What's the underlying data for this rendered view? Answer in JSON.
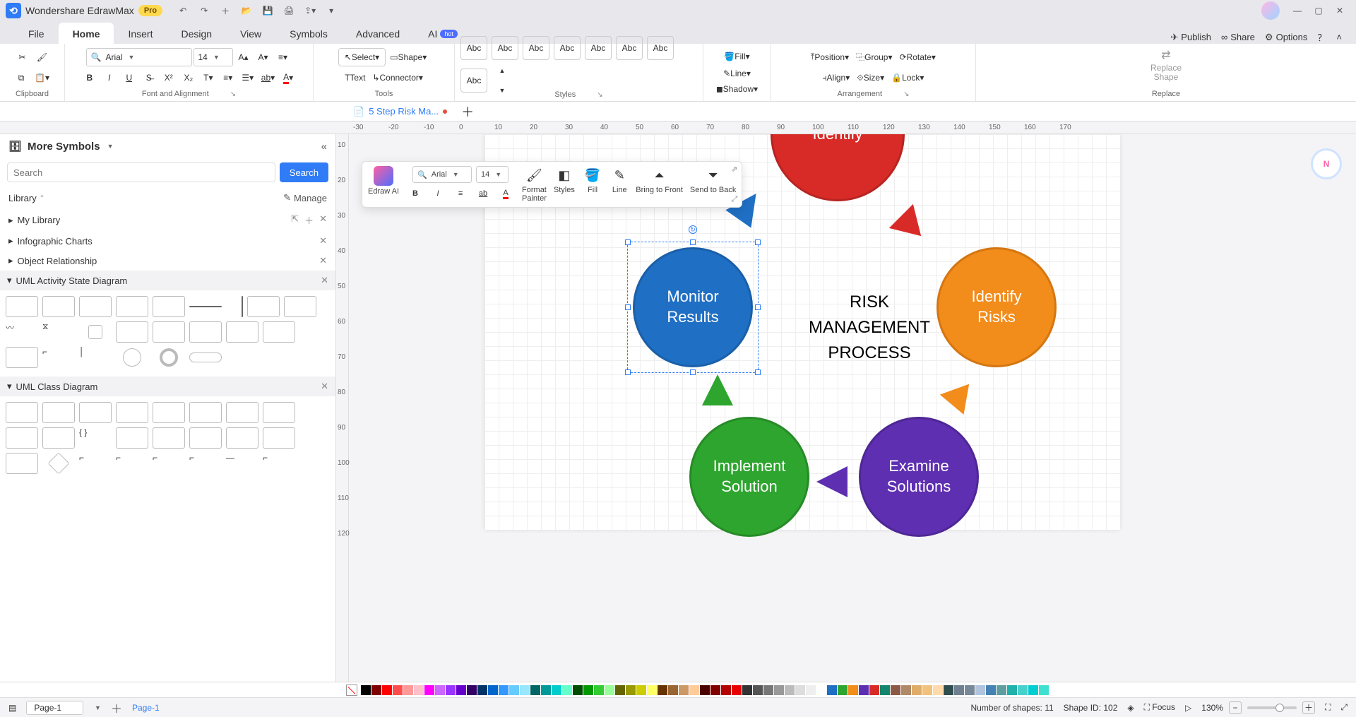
{
  "app": {
    "name": "Wondershare EdrawMax",
    "badge": "Pro"
  },
  "menus": [
    "File",
    "Home",
    "Insert",
    "Design",
    "View",
    "Symbols",
    "Advanced",
    "AI"
  ],
  "menu_active": 1,
  "menu_hot": "hot",
  "top_right": {
    "publish": "Publish",
    "share": "Share",
    "options": "Options"
  },
  "ribbon": {
    "clipboard": "Clipboard",
    "font_align": "Font and Alignment",
    "tools": "Tools",
    "styles": "Styles",
    "arrangement": "Arrangement",
    "replace": "Replace",
    "font_name": "Arial",
    "font_size": "14",
    "select": "Select",
    "text": "Text",
    "shape": "Shape",
    "connector": "Connector",
    "abc": "Abc",
    "fill": "Fill",
    "line": "Line",
    "shadow": "Shadow",
    "position": "Position",
    "group": "Group",
    "rotate": "Rotate",
    "align": "Align",
    "size": "Size",
    "lock": "Lock",
    "replace_shape": "Replace\nShape"
  },
  "doc_tab": "5 Step Risk Ma...",
  "ruler_h": [
    "-30",
    "-20",
    "-10",
    "0",
    "10",
    "20",
    "30",
    "40",
    "50",
    "60",
    "70",
    "80",
    "90",
    "100",
    "110",
    "120",
    "130",
    "140",
    "150",
    "160",
    "170"
  ],
  "ruler_v": [
    "10",
    "20",
    "30",
    "40",
    "50",
    "60",
    "70",
    "80",
    "90",
    "100",
    "110",
    "120"
  ],
  "sidebar": {
    "title": "More Symbols",
    "search_ph": "Search",
    "search_btn": "Search",
    "library": "Library",
    "manage": "Manage",
    "my_library": "My Library",
    "cat1": "Infographic Charts",
    "cat2": "Object Relationship",
    "cat3": "UML Activity State Diagram",
    "cat4": "UML Class Diagram"
  },
  "float": {
    "ai": "Edraw AI",
    "font": "Arial",
    "size": "14",
    "format": "Format\nPainter",
    "styles": "Styles",
    "fill": "Fill",
    "line": "Line",
    "front": "Bring to Front",
    "back": "Send to Back"
  },
  "diagram": {
    "center": "RISK\nMANAGEMENT\nPROCESS",
    "red": "Identify",
    "blue": "Monitor\nResults",
    "orange": "Identify\nRisks",
    "green": "Implement\nSolution",
    "purple": "Examine\nSolutions"
  },
  "status": {
    "page_sel": "Page-1",
    "page_link": "Page-1",
    "shapes": "Number of shapes: 11",
    "shape_id": "Shape ID: 102",
    "focus": "Focus",
    "zoom": "130%"
  },
  "colors": [
    "#000",
    "#7f0000",
    "#ff0000",
    "#ff4d4d",
    "#ff9999",
    "#ffc0cb",
    "#ff00ff",
    "#cc66ff",
    "#9933ff",
    "#6600cc",
    "#330066",
    "#003366",
    "#0066cc",
    "#3399ff",
    "#66ccff",
    "#99e6ff",
    "#006666",
    "#009999",
    "#00cccc",
    "#66ffcc",
    "#004d00",
    "#009900",
    "#33cc33",
    "#99ff99",
    "#666600",
    "#999900",
    "#cccc00",
    "#ffff66",
    "#663300",
    "#996633",
    "#cc9966",
    "#ffcc99",
    "#4d0000",
    "#800000",
    "#b30000",
    "#e60000",
    "#333",
    "#555",
    "#777",
    "#999",
    "#bbb",
    "#ddd",
    "#eee",
    "#fff",
    "#1f6fc4",
    "#2ea52e",
    "#f28c1a",
    "#5e2fb0",
    "#d82b27",
    "#14866d",
    "#8a5a44",
    "#b08968",
    "#e0ac69",
    "#f1c27d",
    "#ffdbac",
    "#2f4f4f",
    "#708090",
    "#778899",
    "#b0c4de",
    "#4682b4",
    "#5f9ea0",
    "#20b2aa",
    "#48d1cc",
    "#00ced1",
    "#40e0d0"
  ]
}
